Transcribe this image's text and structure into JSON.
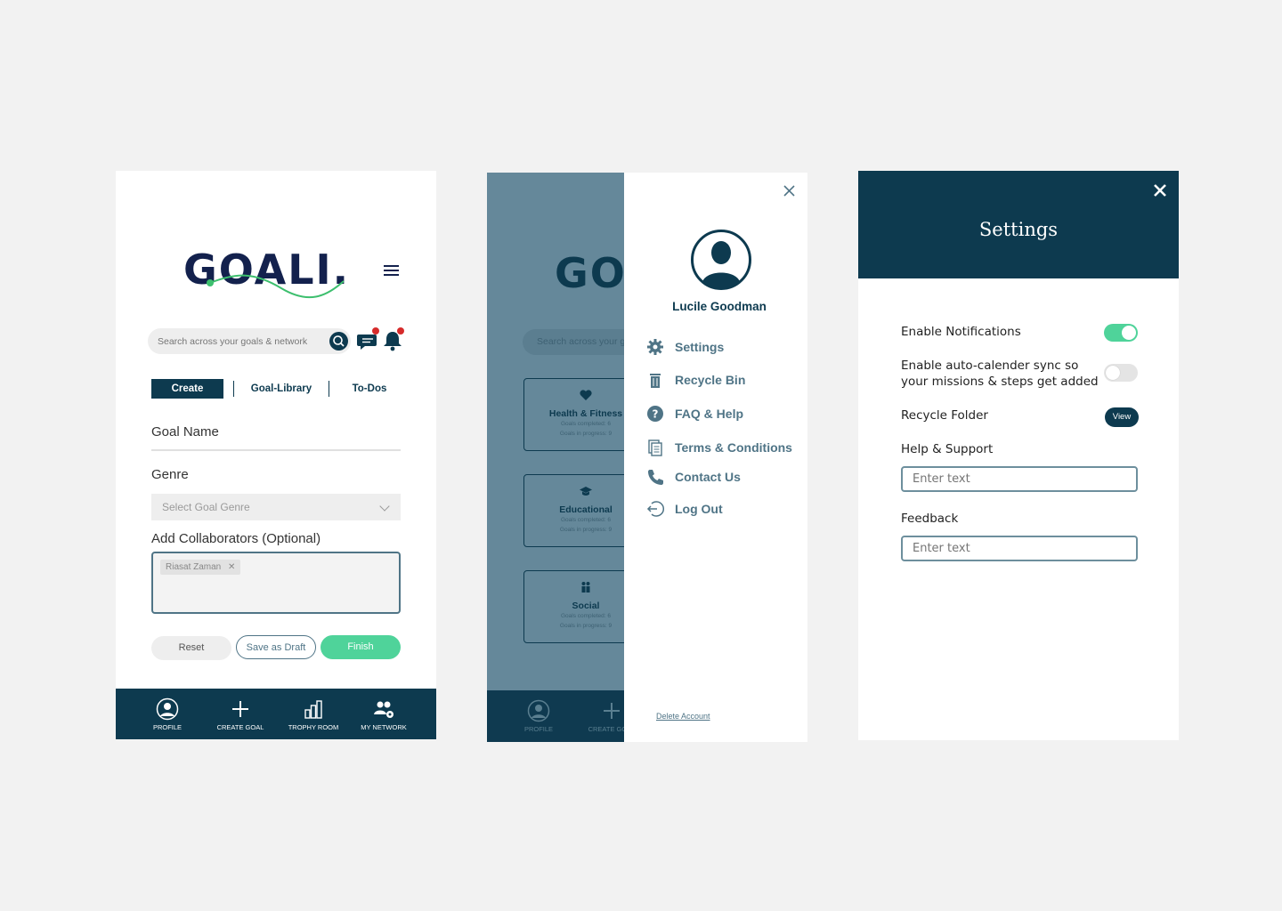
{
  "screen1": {
    "logo_text": "GOALI.",
    "search_placeholder": "Search across your goals & network",
    "tabs": [
      "Create",
      "Goal-Library",
      "To-Dos"
    ],
    "goal_name_label": "Goal Name",
    "genre_label": "Genre",
    "genre_placeholder": "Select Goal Genre",
    "collab_label": "Add Collaborators (Optional)",
    "collab_chip": "Riasat Zaman",
    "buttons": {
      "reset": "Reset",
      "draft": "Save as Draft",
      "finish": "Finish"
    },
    "nav": [
      "PROFILE",
      "CREATE GOAL",
      "TROPHY ROOM",
      "MY NETWORK"
    ]
  },
  "screen2": {
    "bg_logo": "GOALI.",
    "bg_search": "Search across your goals & network",
    "cards": [
      {
        "title": "Health & Fitness",
        "completed": "Goals completed: 6",
        "progress": "Goals in progress: 9",
        "icon": "heart-icon"
      },
      {
        "title": "Educational",
        "completed": "Goals completed: 6",
        "progress": "Goals in progress: 9",
        "icon": "graduation-cap-icon"
      },
      {
        "title": "Social",
        "completed": "Goals completed: 6",
        "progress": "Goals in progress: 9",
        "icon": "people-icon"
      }
    ],
    "bg_nav": [
      "PROFILE",
      "CREATE GOAL"
    ],
    "user_name": "Lucile Goodman",
    "menu": [
      {
        "label": "Settings",
        "icon": "gear-icon"
      },
      {
        "label": "Recycle Bin",
        "icon": "trash-icon"
      },
      {
        "label": "FAQ & Help",
        "icon": "question-icon"
      },
      {
        "label": "Terms & Conditions",
        "icon": "document-icon"
      },
      {
        "label": "Contact Us",
        "icon": "phone-icon"
      },
      {
        "label": "Log Out",
        "icon": "logout-icon"
      }
    ],
    "delete_account": "Delete Account"
  },
  "screen3": {
    "title": "Settings",
    "enable_notifications": "Enable Notifications",
    "notifications_on": true,
    "auto_sync_line1": "Enable auto-calender sync so",
    "auto_sync_line2": "your missions & steps get added",
    "auto_sync_on": false,
    "recycle_folder": "Recycle Folder",
    "view_label": "View",
    "help_label": "Help & Support",
    "help_placeholder": "Enter text",
    "feedback_label": "Feedback",
    "feedback_placeholder": "Enter text"
  },
  "colors": {
    "primary": "#0d3a4f",
    "accent": "#4fd39a",
    "logo": "#13214d",
    "badge": "#d62b2b"
  }
}
